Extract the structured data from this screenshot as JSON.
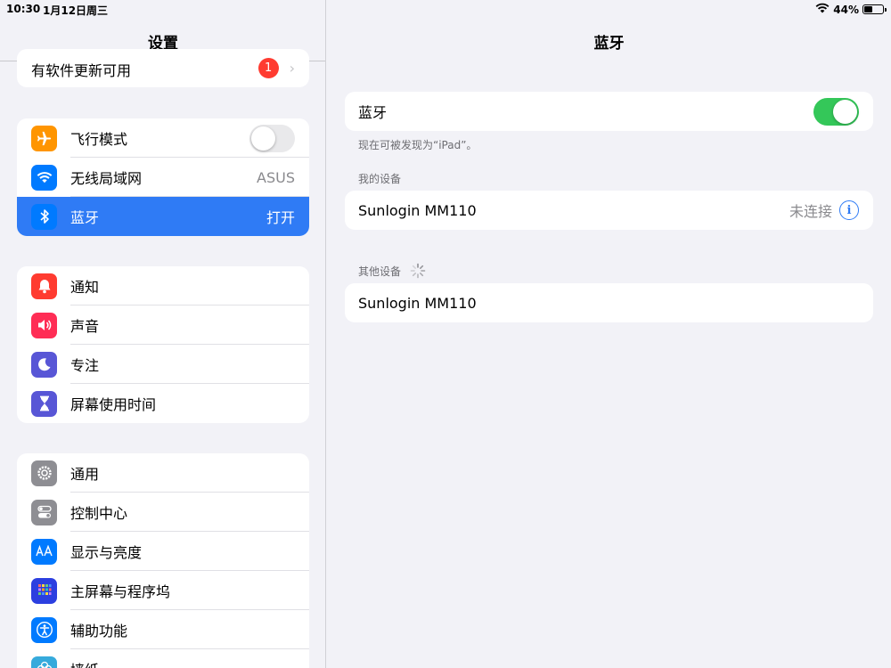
{
  "status_bar": {
    "time": "10:30",
    "date": "1月12日周三",
    "battery": "44%",
    "battery_level": 0.44
  },
  "sidebar": {
    "title": "设置",
    "update_row": {
      "label": "有软件更新可用",
      "badge": "1"
    },
    "group1": [
      {
        "label": "飞行模式",
        "icon": "airplane-icon",
        "color": "#ff9500",
        "toggle": false
      },
      {
        "label": "无线局域网",
        "icon": "wifi-icon",
        "color": "#007aff",
        "value": "ASUS"
      },
      {
        "label": "蓝牙",
        "icon": "bluetooth-icon",
        "color": "#007aff",
        "value": "打开",
        "selected": true
      }
    ],
    "group2": [
      {
        "label": "通知",
        "icon": "bell-icon",
        "color": "#ff3b30"
      },
      {
        "label": "声音",
        "icon": "speaker-icon",
        "color": "#ff2d55"
      },
      {
        "label": "专注",
        "icon": "moon-icon",
        "color": "#5856d6"
      },
      {
        "label": "屏幕使用时间",
        "icon": "hourglass-icon",
        "color": "#5856d6"
      }
    ],
    "group3": [
      {
        "label": "通用",
        "icon": "gear-icon",
        "color": "#8e8e93"
      },
      {
        "label": "控制中心",
        "icon": "switches-icon",
        "color": "#8e8e93"
      },
      {
        "label": "显示与亮度",
        "icon": "text-size-icon",
        "color": "#007aff"
      },
      {
        "label": "主屏幕与程序坞",
        "icon": "grid-icon",
        "color": "#2c3fe0"
      },
      {
        "label": "辅助功能",
        "icon": "accessibility-icon",
        "color": "#007aff"
      },
      {
        "label": "墙纸",
        "icon": "wallpaper-icon",
        "color": "#36aadc"
      }
    ]
  },
  "main": {
    "title": "蓝牙",
    "bluetooth_toggle": {
      "label": "蓝牙",
      "on": true
    },
    "discoverable_text": "现在可被发现为“iPad”。",
    "my_devices_header": "我的设备",
    "my_devices": [
      {
        "name": "Sunlogin MM110",
        "status": "未连接"
      }
    ],
    "other_devices_header": "其他设备",
    "other_devices": [
      {
        "name": "Sunlogin MM110"
      }
    ]
  }
}
